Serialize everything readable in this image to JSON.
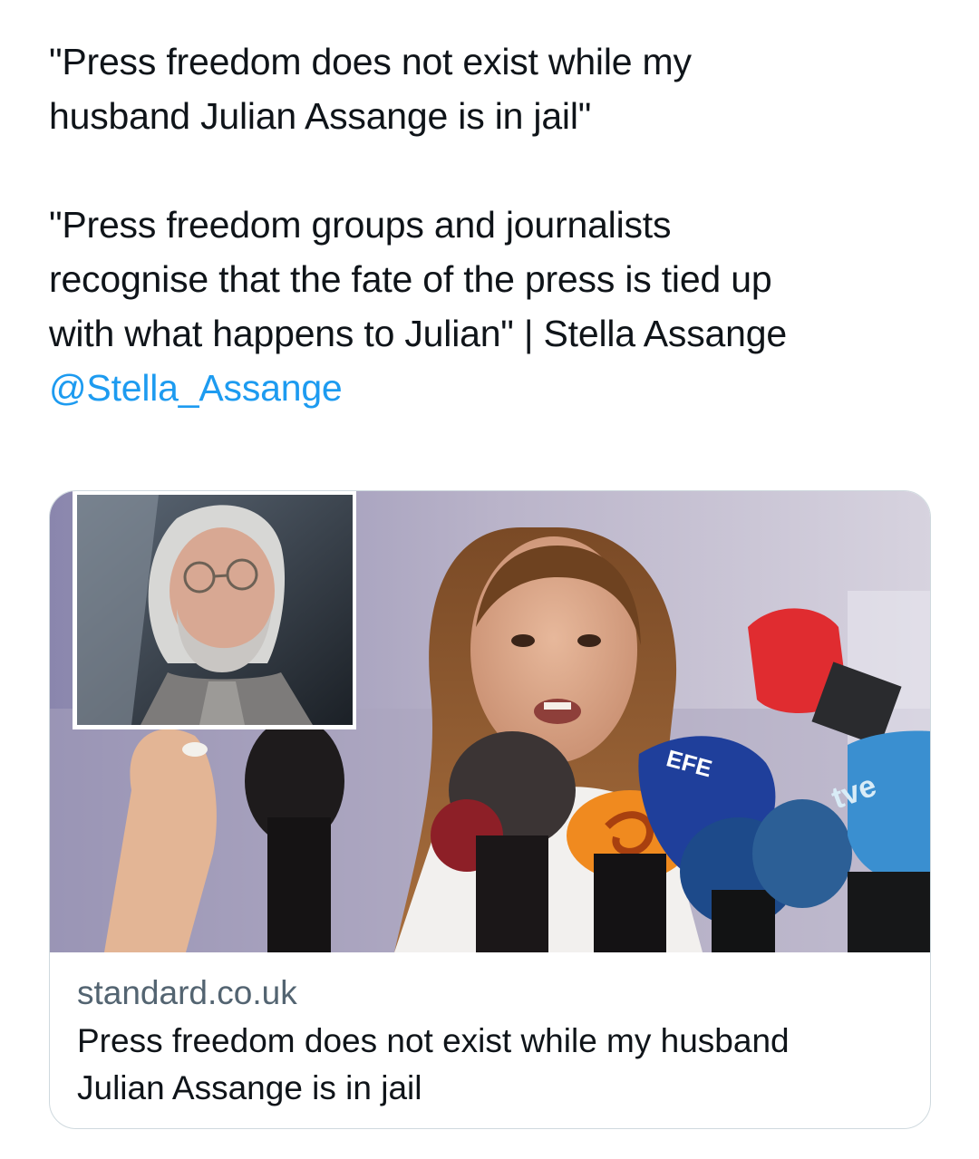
{
  "tweet": {
    "paragraph1": "\"Press freedom does not exist while my\nhusband Julian Assange is in jail\"",
    "paragraph2": "\"Press freedom groups and journalists\nrecognise that the fate of the press is tied up\nwith what happens to Julian\" | Stella Assange",
    "mention": "@Stella_Assange"
  },
  "card": {
    "domain": "standard.co.uk",
    "title": "Press freedom does not exist while my husband\nJulian Assange is in jail",
    "image_marks": [
      "EFE",
      "tve"
    ]
  },
  "colors": {
    "text": "#0f1419",
    "mention": "#1d9bf0",
    "secondary": "#536471",
    "border": "#cfd9de"
  }
}
